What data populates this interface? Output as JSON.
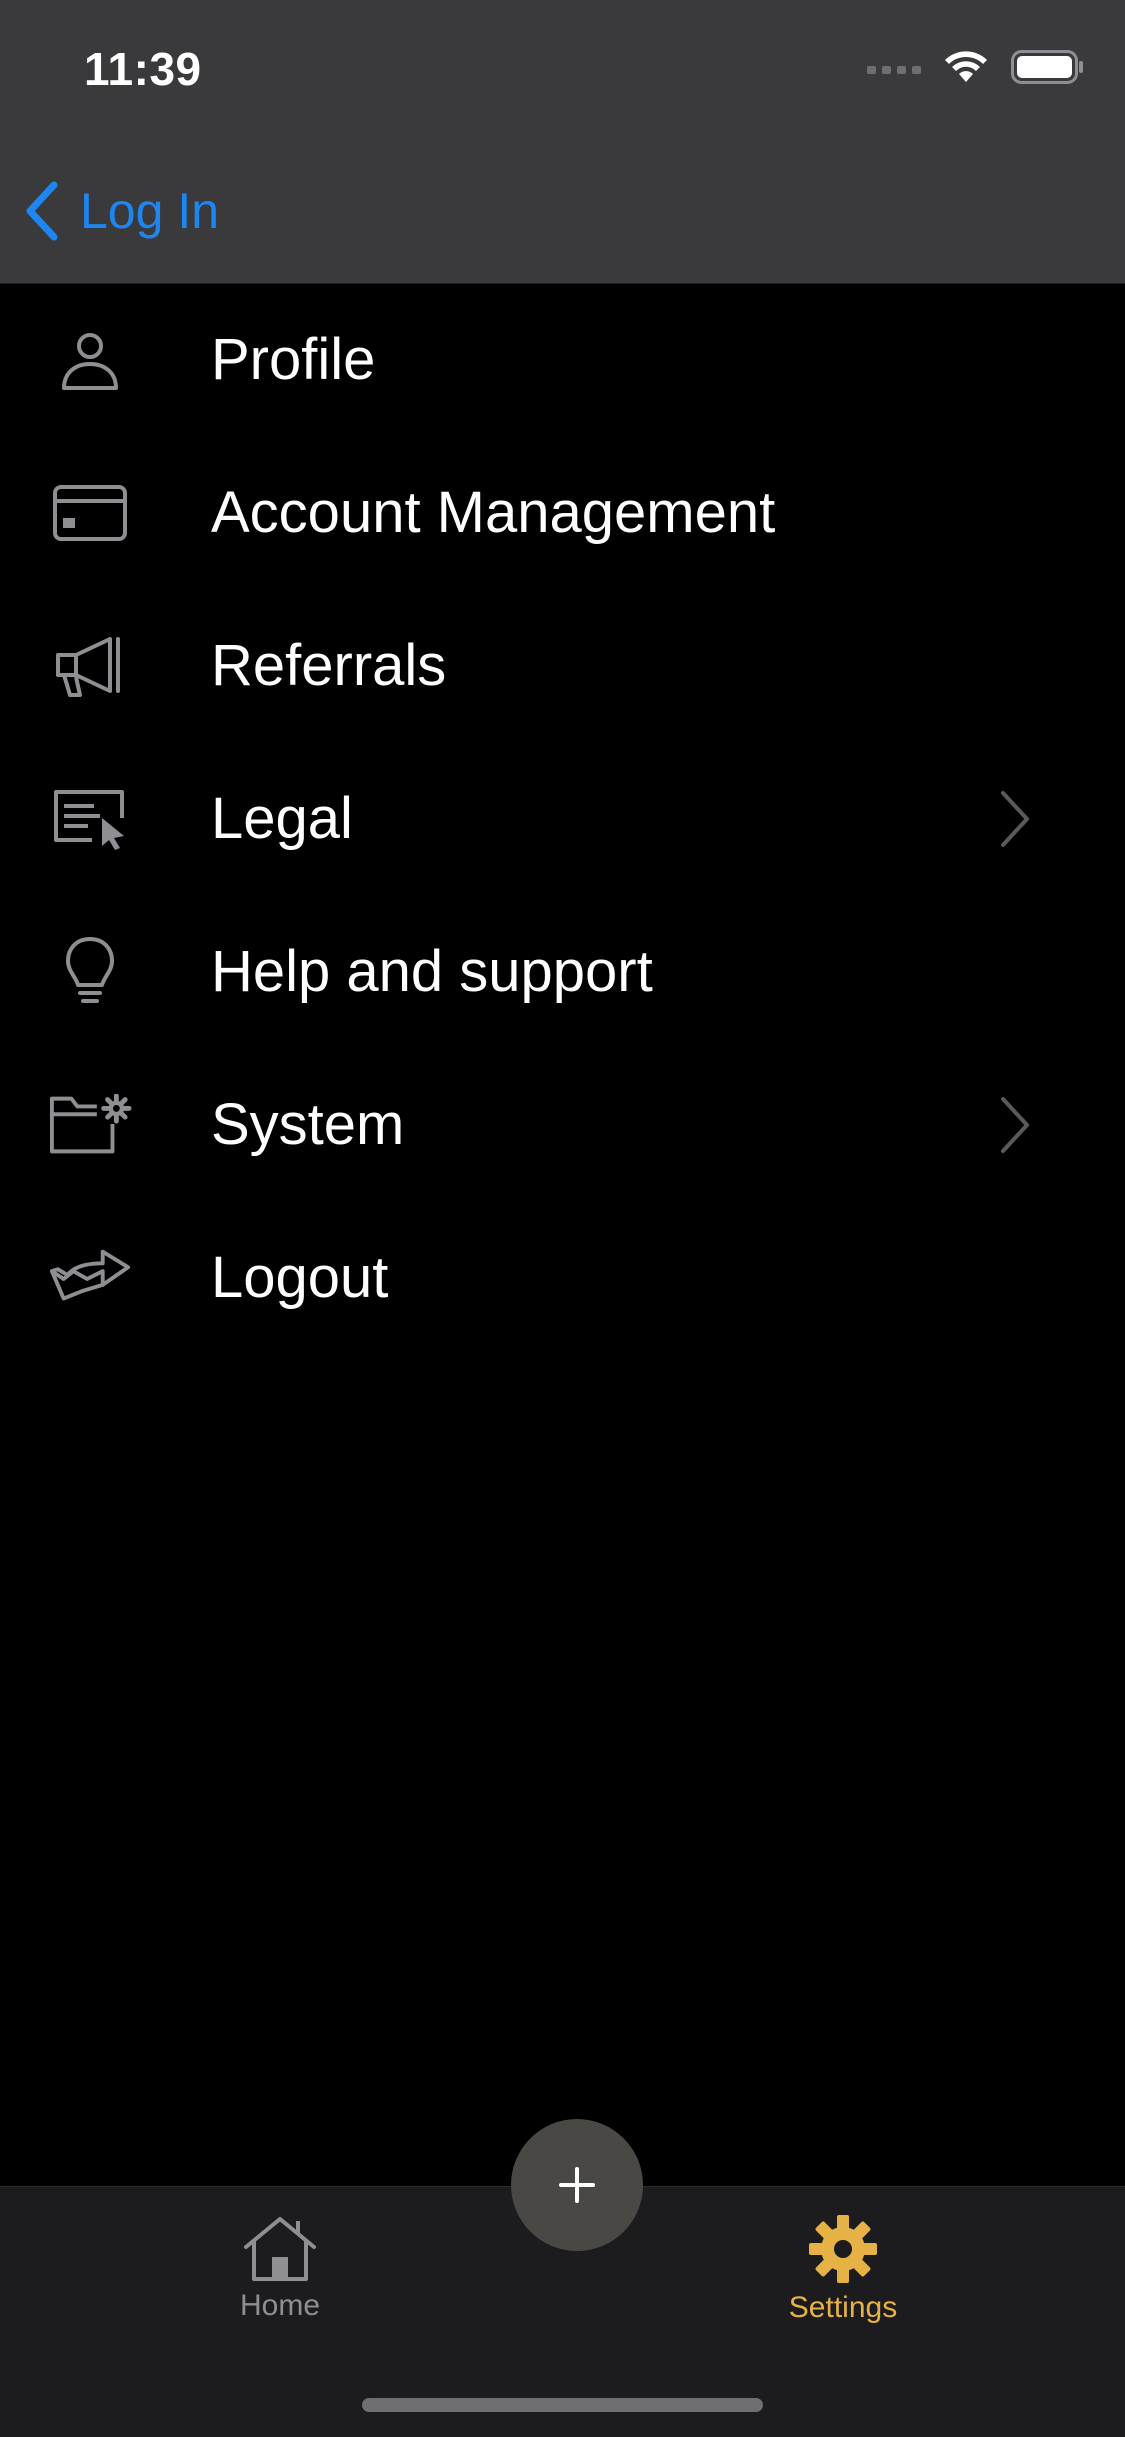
{
  "status_bar": {
    "time": "11:39"
  },
  "nav": {
    "back_label": "Log In"
  },
  "menu": {
    "items": [
      {
        "label": "Profile",
        "icon": "person-icon"
      },
      {
        "label": "Account Management",
        "icon": "credit-card-icon"
      },
      {
        "label": "Referrals",
        "icon": "megaphone-icon"
      },
      {
        "label": "Legal",
        "icon": "document-cursor-icon",
        "has_chevron": true
      },
      {
        "label": "Help and support",
        "icon": "lightbulb-icon"
      },
      {
        "label": "System",
        "icon": "folder-gear-icon",
        "has_chevron": true
      },
      {
        "label": "Logout",
        "icon": "share-arrow-icon"
      }
    ]
  },
  "tab_bar": {
    "home_label": "Home",
    "settings_label": "Settings",
    "active_tab": "Settings"
  },
  "colors": {
    "accent_blue": "#1e86f0",
    "active_tab": "#e7b245",
    "icon_gray": "#8e8e93"
  }
}
